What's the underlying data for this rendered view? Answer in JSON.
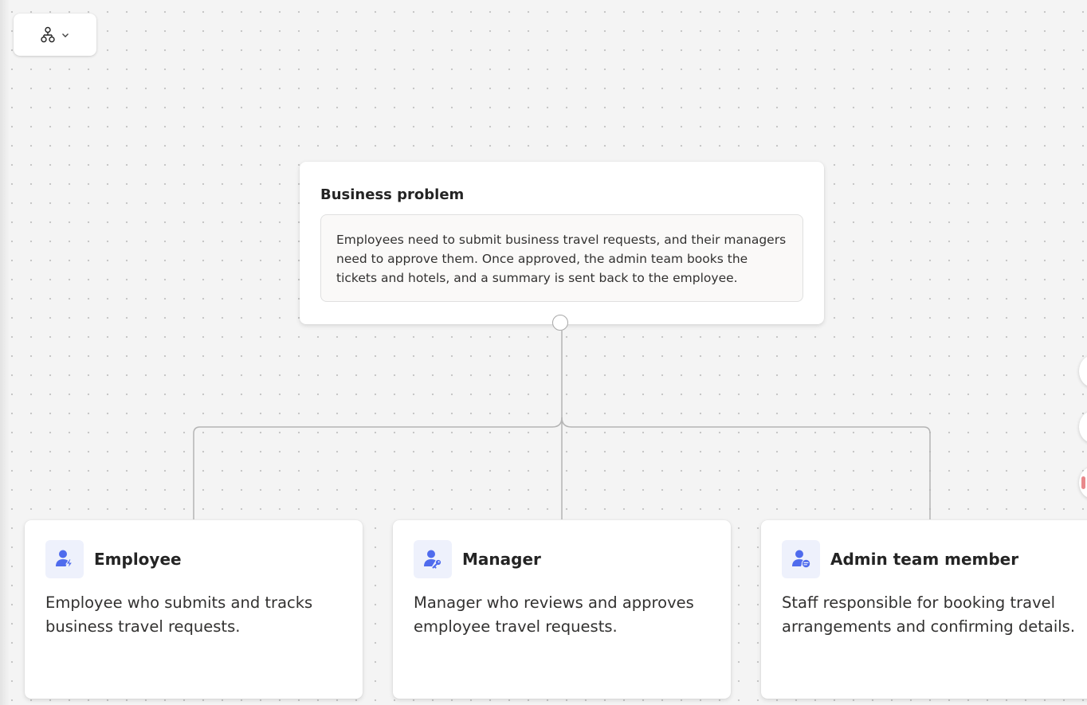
{
  "problem": {
    "title": "Business problem",
    "description": "Employees need to submit business travel requests, and their managers need to approve them. Once approved, the admin team books the tickets and hotels, and a summary is sent back to the employee."
  },
  "roles": [
    {
      "title": "Employee",
      "description": "Employee who submits and tracks business travel requests.",
      "icon": "person-lightning-icon"
    },
    {
      "title": "Manager",
      "description": "Manager who reviews and approves employee travel requests.",
      "icon": "person-key-icon"
    },
    {
      "title": "Admin team member",
      "description": "Staff responsible for booking travel arrangements and confirming details.",
      "icon": "person-chat-icon"
    }
  ],
  "toolbar": {
    "view_icon": "org-chart-icon",
    "dropdown_icon": "chevron-down-icon"
  },
  "colors": {
    "accent": "#4f6bed",
    "connector": "#b4b4b4",
    "canvas": "#f4f4f4"
  }
}
